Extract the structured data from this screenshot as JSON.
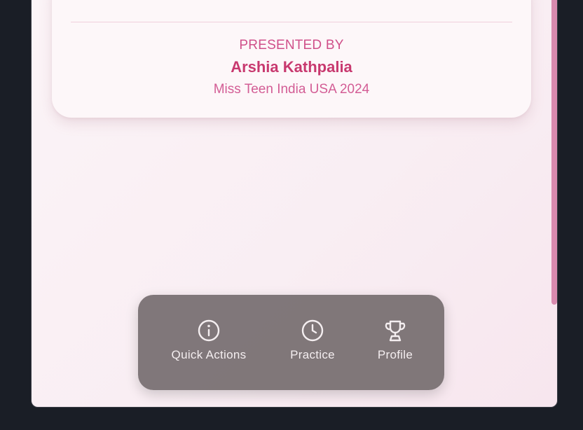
{
  "card": {
    "presented_by": "PRESENTED BY",
    "presenter_name": "Arshia Kathpalia",
    "presenter_title": "Miss Teen India USA 2024"
  },
  "nav": {
    "items": [
      {
        "label": "Quick Actions",
        "icon": "info-icon"
      },
      {
        "label": "Practice",
        "icon": "clock-icon"
      },
      {
        "label": "Profile",
        "icon": "trophy-icon"
      }
    ]
  },
  "colors": {
    "page_background": "#1a1e26",
    "app_background": "#f9eef3",
    "accent": "#c8396f",
    "accent_light": "#d35d95",
    "nav_background": "#766e70",
    "nav_text": "#f4eef0"
  }
}
